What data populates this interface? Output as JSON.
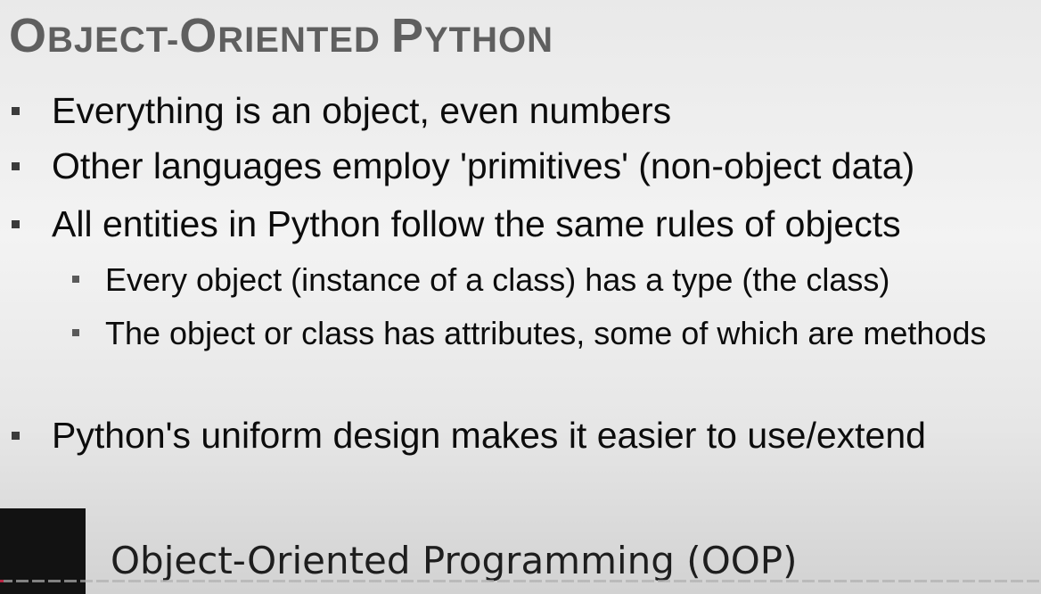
{
  "slide": {
    "title_parts": [
      {
        "text": "O",
        "cls": "cap"
      },
      {
        "text": "BJECT-",
        "cls": "sc"
      },
      {
        "text": "O",
        "cls": "cap"
      },
      {
        "text": "RIENTED ",
        "cls": "sc"
      },
      {
        "text": "P",
        "cls": "cap"
      },
      {
        "text": "YTHON",
        "cls": "sc"
      }
    ],
    "bullets": [
      {
        "level": 1,
        "text": "Everything is an object, even numbers"
      },
      {
        "level": 1,
        "text": "Other languages employ 'primitives' (non-object data)"
      },
      {
        "level": 1,
        "text": "All entities in Python follow the same rules of objects"
      },
      {
        "level": 2,
        "text": "Every object (instance of a class) has a type (the class)"
      },
      {
        "level": 2,
        "text": "The object or class has attributes, some of which are methods"
      },
      {
        "level": 1,
        "text": "Python's uniform design makes it easier to use/extend"
      }
    ]
  },
  "caption": {
    "text": "Object-Oriented Programming (OOP)"
  },
  "player": {
    "progress": 0.003,
    "played_color": "#ff2a55"
  }
}
